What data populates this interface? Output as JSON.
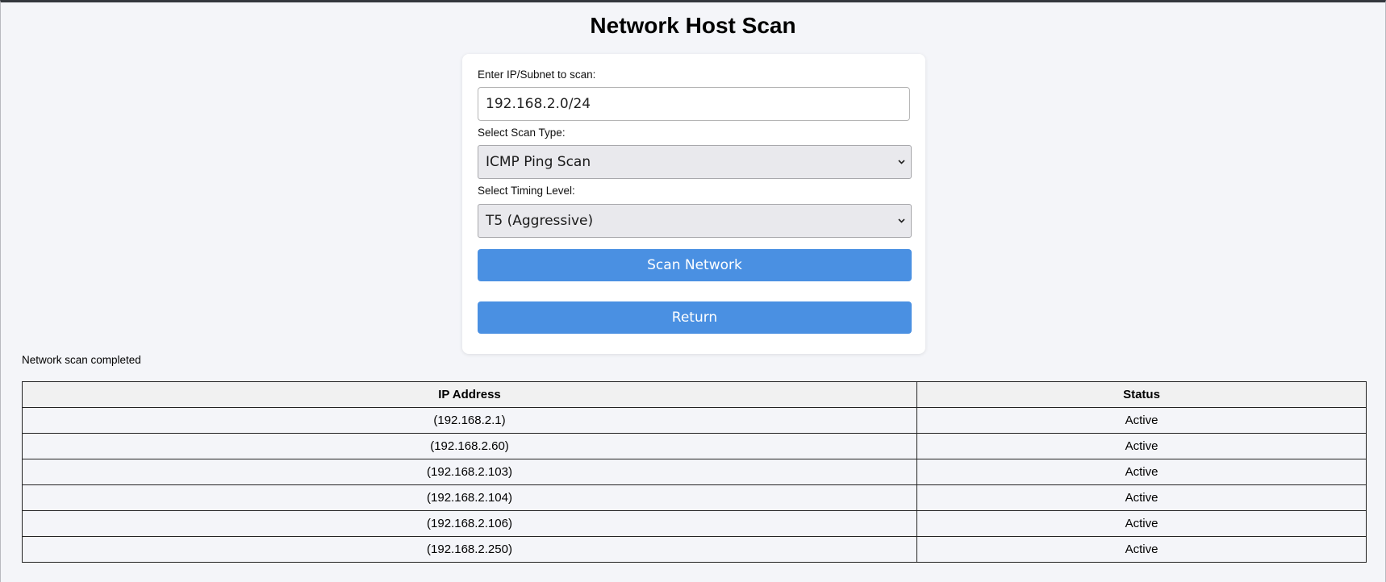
{
  "page": {
    "title": "Network Host Scan"
  },
  "form": {
    "ip_label": "Enter IP/Subnet to scan:",
    "ip_value": "192.168.2.0/24",
    "scan_type_label": "Select Scan Type:",
    "scan_type_value": "ICMP Ping Scan",
    "timing_label": "Select Timing Level:",
    "timing_value": "T5 (Aggressive)",
    "scan_button": "Scan Network",
    "return_button": "Return"
  },
  "status": "Network scan completed",
  "results": {
    "headers": {
      "ip": "IP Address",
      "status": "Status"
    },
    "rows": [
      {
        "ip": "(192.168.2.1)",
        "status": "Active"
      },
      {
        "ip": "(192.168.2.60)",
        "status": "Active"
      },
      {
        "ip": "(192.168.2.103)",
        "status": "Active"
      },
      {
        "ip": "(192.168.2.104)",
        "status": "Active"
      },
      {
        "ip": "(192.168.2.106)",
        "status": "Active"
      },
      {
        "ip": "(192.168.2.250)",
        "status": "Active"
      }
    ]
  },
  "colors": {
    "accent": "#4a90e2",
    "background": "#f4f5f9"
  },
  "icons": {
    "select_arrow": "chevron-down-icon"
  }
}
